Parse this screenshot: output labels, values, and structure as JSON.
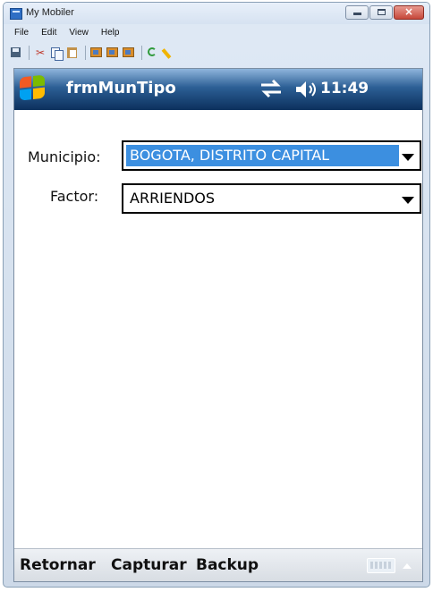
{
  "window": {
    "title": "My Mobiler",
    "menu": [
      "File",
      "Edit",
      "View",
      "Help"
    ]
  },
  "toolbar": {
    "icons": [
      "save-icon",
      "cut-icon",
      "copy-icon",
      "paste-icon",
      "screenshot-icon",
      "screenshot-icon",
      "screenshot-icon",
      "refresh-icon",
      "pen-icon"
    ]
  },
  "device": {
    "form_title": "frmMunTipo",
    "clock": "11:49",
    "status_icons": [
      "connectivity-icon",
      "volume-icon"
    ]
  },
  "form": {
    "municipio_label": "Municipio:",
    "municipio_value": "BOGOTA, DISTRITO CAPITAL",
    "factor_label": "Factor:",
    "factor_value": "ARRIENDOS"
  },
  "softkeys": {
    "retornar": "Retornar",
    "capturar": "Capturar",
    "backup": "Backup"
  },
  "colors": {
    "selection": "#3c8fe0",
    "topbar_dark": "#0c305d",
    "topbar_light": "#8fb5dc"
  }
}
